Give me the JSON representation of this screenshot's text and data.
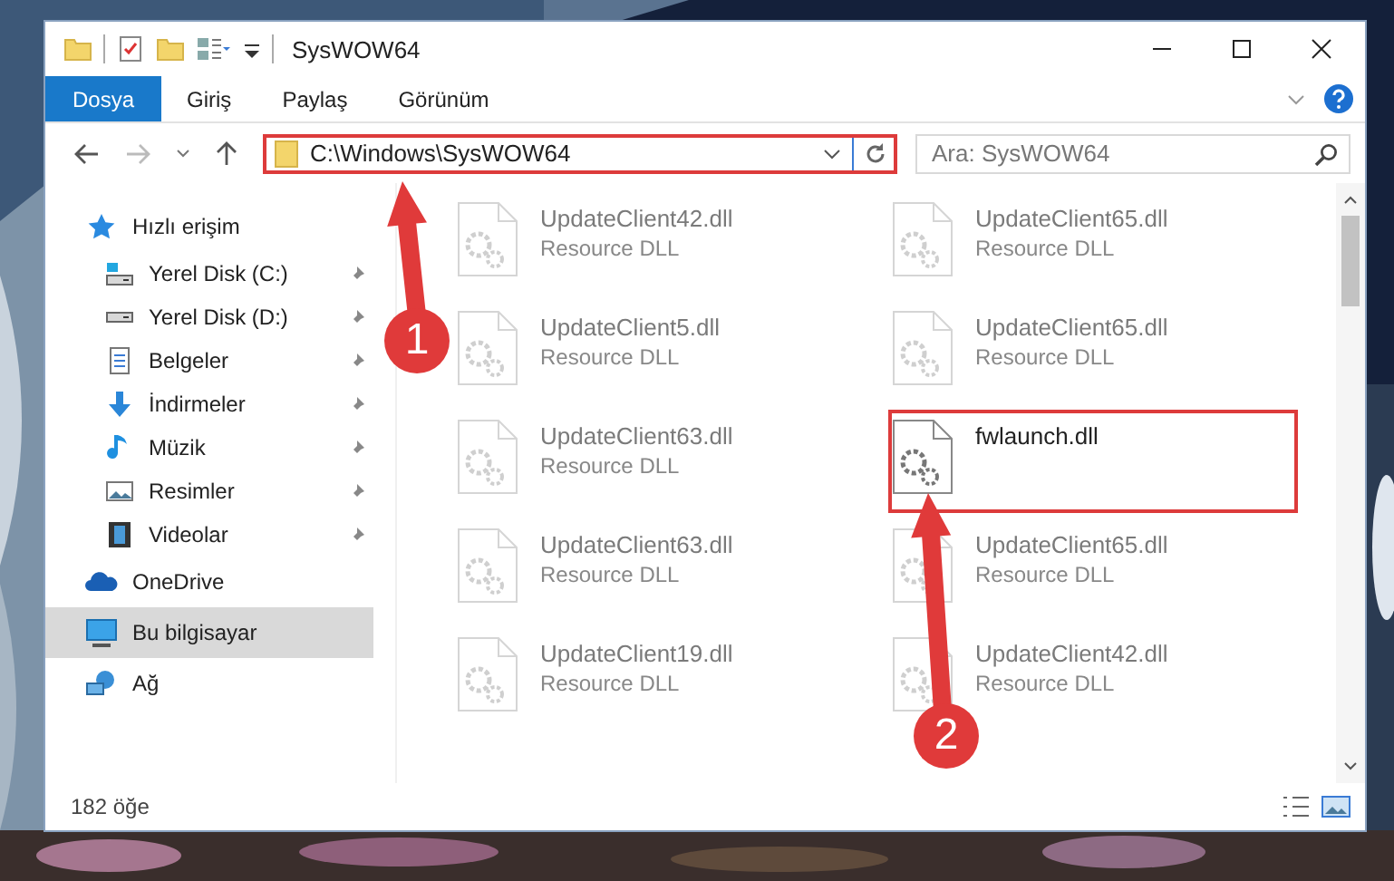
{
  "window": {
    "title": "SysWOW64"
  },
  "ribbon_tabs": [
    {
      "label": "Dosya",
      "selected": true
    },
    {
      "label": "Giriş",
      "selected": false
    },
    {
      "label": "Paylaş",
      "selected": false
    },
    {
      "label": "Görünüm",
      "selected": false
    }
  ],
  "address": {
    "value": "C:\\Windows\\SysWOW64",
    "highlighted": true
  },
  "search": {
    "placeholder": "Ara: SysWOW64"
  },
  "sidebar": {
    "items": [
      {
        "label": "Hızlı erişim",
        "kind": "star",
        "selected": false,
        "children": [
          {
            "label": "Yerel Disk (C:)",
            "kind": "systemdrive",
            "pinned": true,
            "selected": false
          },
          {
            "label": "Yerel Disk (D:)",
            "kind": "drive",
            "pinned": true,
            "selected": false
          },
          {
            "label": "Belgeler",
            "kind": "documents",
            "pinned": true,
            "selected": false
          },
          {
            "label": "İndirmeler",
            "kind": "download",
            "pinned": true,
            "selected": false
          },
          {
            "label": "Müzik",
            "kind": "music",
            "pinned": true,
            "selected": false
          },
          {
            "label": "Resimler",
            "kind": "pictures",
            "pinned": true,
            "selected": false
          },
          {
            "label": "Videolar",
            "kind": "videos",
            "pinned": true,
            "selected": false
          }
        ]
      },
      {
        "label": "OneDrive",
        "kind": "cloud",
        "selected": false
      },
      {
        "label": "Bu bilgisayar",
        "kind": "computer",
        "selected": true
      },
      {
        "label": "Ağ",
        "kind": "network",
        "selected": false
      }
    ]
  },
  "files": [
    {
      "name": "UpdateClient42.dll",
      "type": "Resource DLL",
      "highlighted": false
    },
    {
      "name": "UpdateClient65.dll",
      "type": "Resource DLL",
      "highlighted": false
    },
    {
      "name": "UpdateClient5.dll",
      "type": "Resource DLL",
      "highlighted": false
    },
    {
      "name": "UpdateClient65.dll",
      "type": "Resource DLL",
      "highlighted": false
    },
    {
      "name": "UpdateClient63.dll",
      "type": "Resource DLL",
      "highlighted": false
    },
    {
      "name": "fwlaunch.dll",
      "highlighted": true
    },
    {
      "name": "UpdateClient63.dll",
      "type": "Resource DLL",
      "highlighted": false
    },
    {
      "name": "UpdateClient65.dll",
      "type": "Resource DLL",
      "highlighted": false
    },
    {
      "name": "UpdateClient19.dll",
      "type": "Resource DLL",
      "highlighted": false
    },
    {
      "name": "UpdateClient42.dll",
      "type": "Resource DLL",
      "highlighted": false
    }
  ],
  "status_bar": {
    "count": "182 öğe"
  },
  "annotations": [
    {
      "label": "1"
    },
    {
      "label": "2"
    }
  ]
}
